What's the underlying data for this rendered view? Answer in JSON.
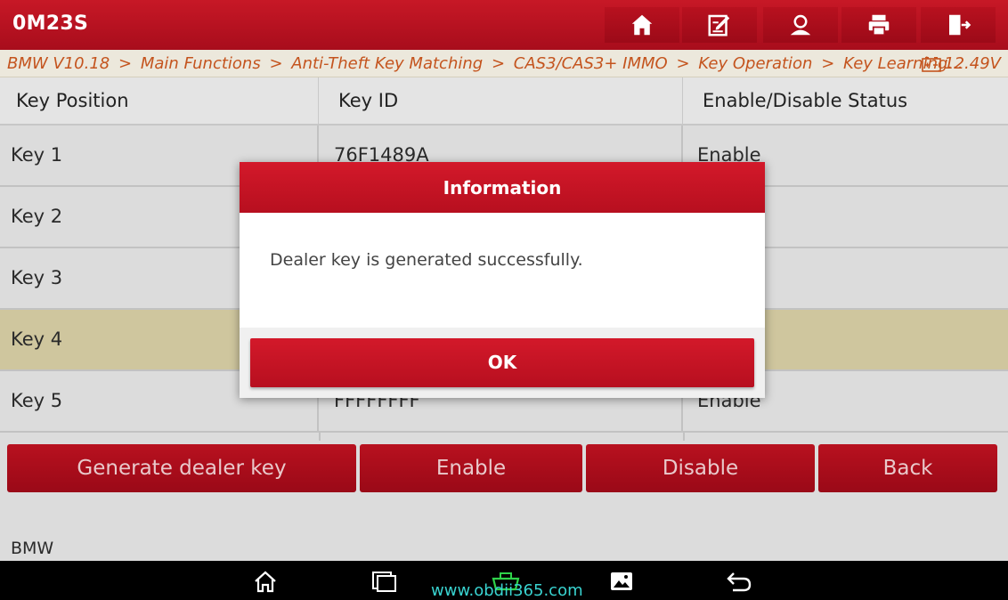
{
  "header": {
    "title": "0M23S",
    "toolbar": [
      {
        "icon": "home-icon"
      },
      {
        "icon": "edit-icon"
      },
      {
        "icon": "user-icon"
      },
      {
        "icon": "printer-icon"
      },
      {
        "icon": "exit-icon"
      }
    ]
  },
  "breadcrumb": {
    "items": [
      "BMW V10.18",
      "Main Functions",
      "Anti-Theft Key Matching",
      "CAS3/CAS3+ IMMO",
      "Key Operation",
      "Key Learning..."
    ],
    "separator": ">",
    "voltage": "12.49V"
  },
  "table": {
    "columns": [
      "Key Position",
      "Key ID",
      "Enable/Disable Status"
    ],
    "rows": [
      {
        "position": "Key 1",
        "key_id": "76F1489A",
        "status": "Enable"
      },
      {
        "position": "Key 2",
        "key_id": "",
        "status": ""
      },
      {
        "position": "Key 3",
        "key_id": "",
        "status": ""
      },
      {
        "position": "Key 4",
        "key_id": "",
        "status": ""
      },
      {
        "position": "Key 5",
        "key_id": "FFFFFFFF",
        "status": "Enable"
      }
    ],
    "selected_row": "Key 4"
  },
  "actions": {
    "generate": "Generate dealer key",
    "enable": "Enable",
    "disable": "Disable",
    "back": "Back"
  },
  "footer": {
    "text": "BMW"
  },
  "dialog": {
    "title": "Information",
    "message": "Dealer key is generated successfully.",
    "ok": "OK"
  },
  "watermark": "www.obdii365.com",
  "colors": {
    "brand_red": "#c71826",
    "selected_row": "#cfc69e",
    "crumb_orange": "#c4541e"
  }
}
